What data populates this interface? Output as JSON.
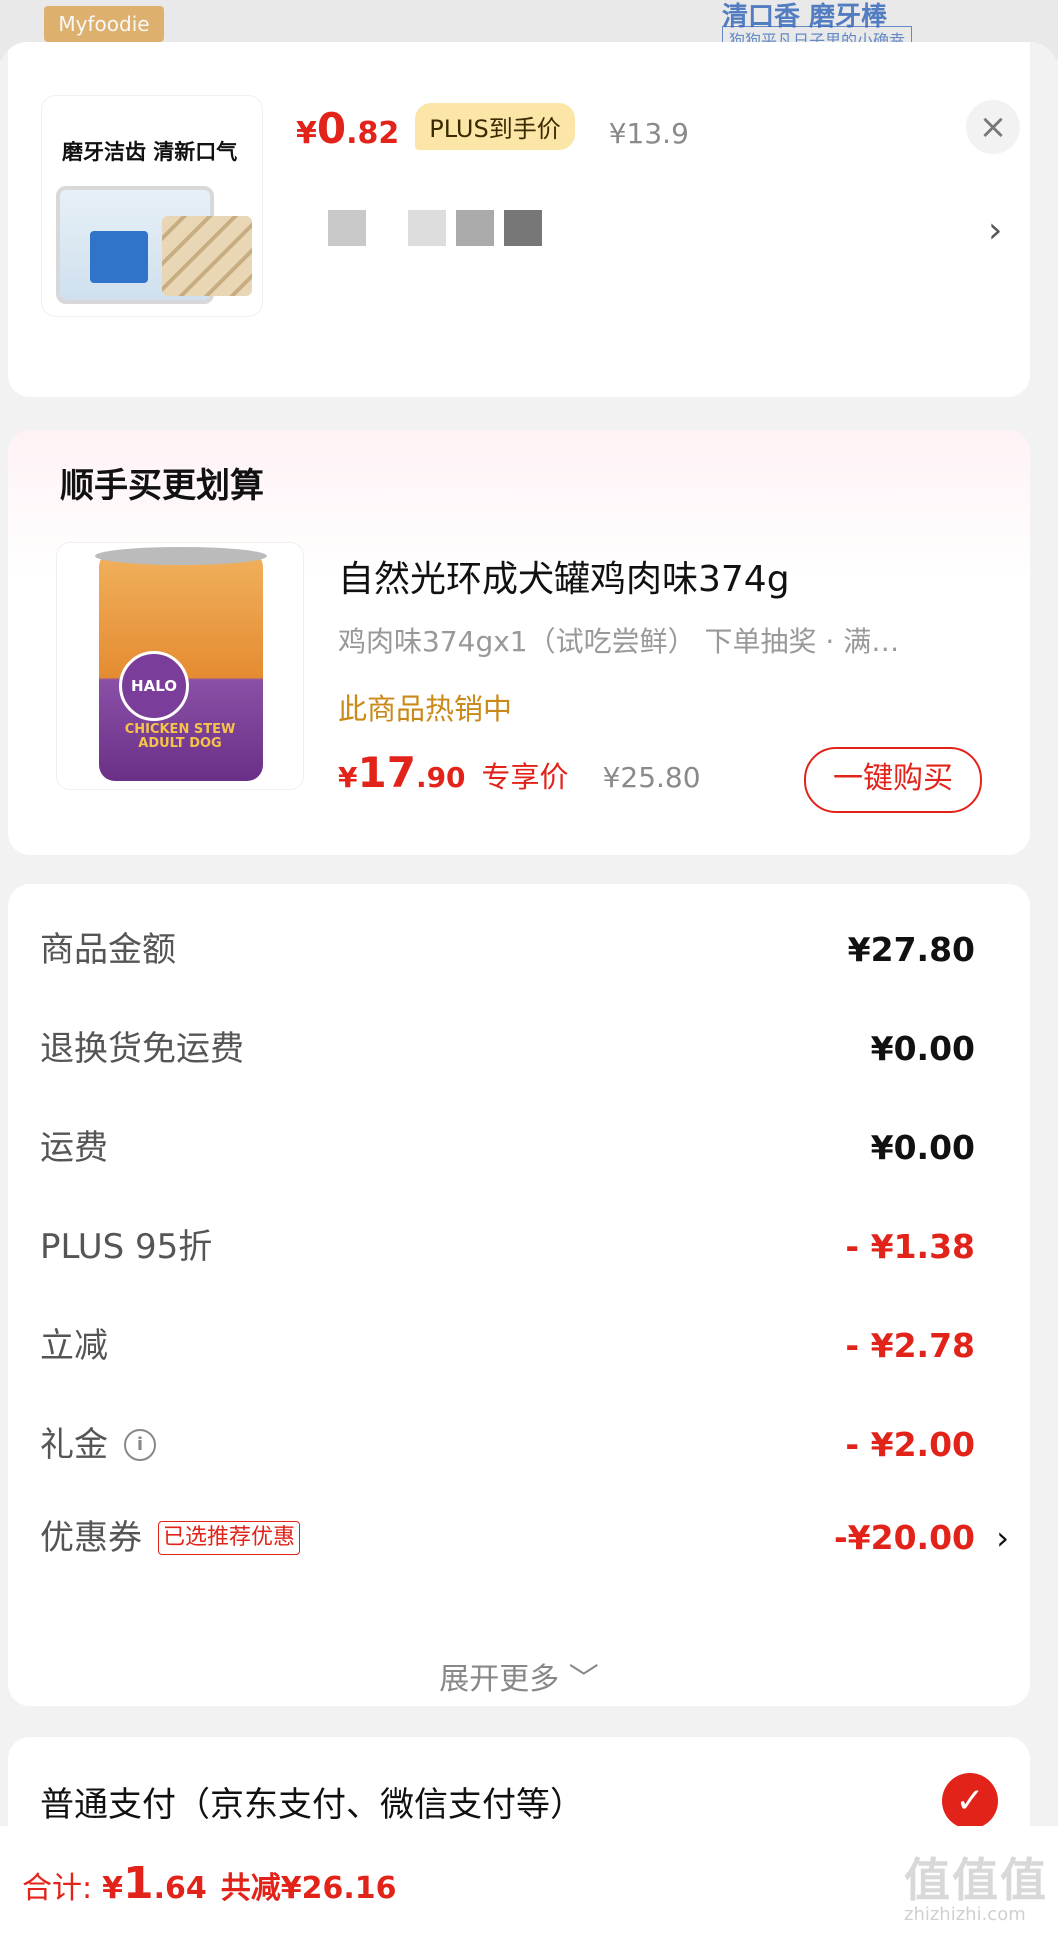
{
  "banner": {
    "brand": "Myfoodie",
    "title": "清口香 磨牙棒",
    "subtitle": "狗狗平凡日子里的小确幸"
  },
  "product": {
    "thumb_caption": "磨牙洁齿 清新口气",
    "price_currency": "¥",
    "price_int": "0",
    "price_dec": ".82",
    "plus_tag": "PLUS到手价",
    "original_price": "¥13.9",
    "close_icon": "close-icon",
    "spec_arrow_icon": "chevron-right-icon"
  },
  "upsell": {
    "title": "顺手买更划算",
    "name": "自然光环成犬罐鸡肉味374g",
    "spec": "鸡肉味374gx1（试吃尝鲜）   下单抽奖 · 满…",
    "hot": "此商品热销中",
    "price_currency": "¥",
    "price_int": "17",
    "price_dec": ".90",
    "price_tag": "专享价",
    "original_price": "¥25.80",
    "buy_button": "一键购买",
    "can_brand": "HALO",
    "can_text": "CHICKEN STEW ADULT DOG"
  },
  "amounts": {
    "rows": [
      {
        "label": "商品金额",
        "value": "¥27.80",
        "red": false
      },
      {
        "label": "退换货免运费",
        "value": "¥0.00",
        "red": false
      },
      {
        "label": "运费",
        "value": "¥0.00",
        "red": false
      },
      {
        "label": "PLUS 95折",
        "value": "- ¥1.38",
        "red": true
      },
      {
        "label": "立减",
        "value": "- ¥2.78",
        "red": true
      },
      {
        "label": "礼金",
        "value": "- ¥2.00",
        "red": true
      },
      {
        "label": "优惠券",
        "value": "-¥20.00",
        "red": true
      }
    ],
    "info_symbol": "i",
    "coupon_tag": "已选推荐优惠",
    "expand": "展开更多 ﹀"
  },
  "payment": {
    "label": "普通支付（京东支付、微信支付等）",
    "check": "✓"
  },
  "footer": {
    "total_label": "合计:",
    "total_currency": "¥",
    "total_int": "1",
    "total_dec": ".64",
    "saved": "共减¥26.16",
    "watermark": "值值值",
    "watermark_sub": "zhizhizhi.com"
  },
  "colors": {
    "accent_red": "#e2231a",
    "plus_gold": "#fbe6a8",
    "hot_orange": "#c98a1a"
  }
}
